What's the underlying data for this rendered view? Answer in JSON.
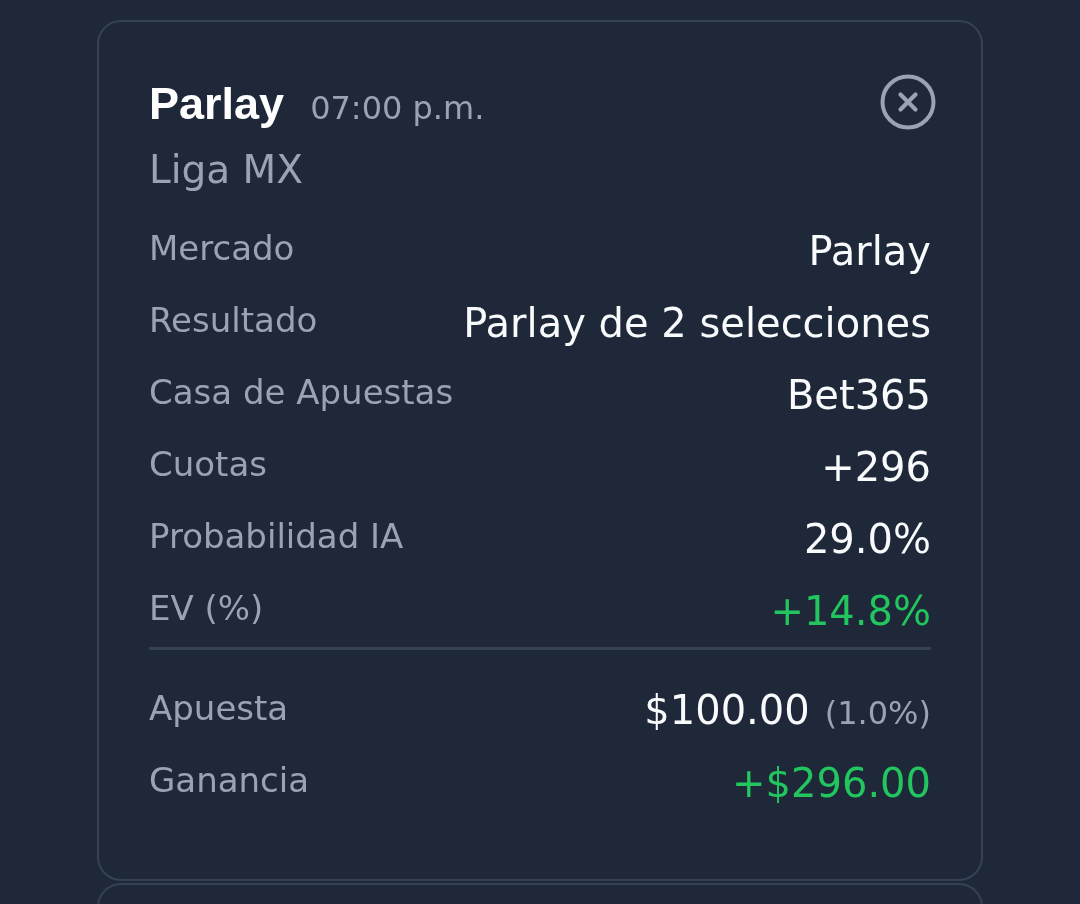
{
  "header": {
    "title": "Parlay",
    "time": "07:00 p.m.",
    "league": "Liga MX"
  },
  "details": [
    {
      "label": "Mercado",
      "value": "Parlay",
      "positive": false
    },
    {
      "label": "Resultado",
      "value": "Parlay de 2 selecciones",
      "positive": false
    },
    {
      "label": "Casa de Apuestas",
      "value": "Bet365",
      "positive": false
    },
    {
      "label": "Cuotas",
      "value": "+296",
      "positive": false
    },
    {
      "label": "Probabilidad IA",
      "value": "29.0%",
      "positive": false
    },
    {
      "label": "EV (%)",
      "value": "+14.8%",
      "positive": true
    }
  ],
  "stake": {
    "label": "Apuesta",
    "amount": "$100.00",
    "share": "(1.0%)"
  },
  "profit": {
    "label": "Ganancia",
    "value": "+$296.00",
    "positive": true
  }
}
